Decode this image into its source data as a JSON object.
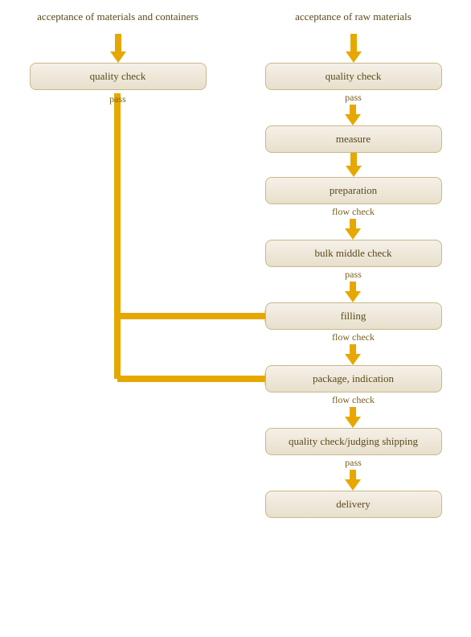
{
  "left": {
    "header": "acceptance of materials and containers",
    "quality_check": "quality check",
    "pass_label": "pass"
  },
  "right": {
    "header": "acceptance of raw materials",
    "quality_check": "quality check",
    "pass1_label": "pass",
    "measure": "measure",
    "preparation": "preparation",
    "flow_check1": "flow check",
    "bulk_middle": "bulk middle check",
    "pass2_label": "pass",
    "filling": "filling",
    "flow_check2": "flow check",
    "package": "package, indication",
    "flow_check3": "flow check",
    "quality_judge": "quality check/judging shipping",
    "pass3_label": "pass",
    "delivery": "delivery"
  },
  "colors": {
    "arrow": "#e6a800",
    "box_bg1": "#f5f0e8",
    "box_bg2": "#e8e0cc",
    "box_border": "#c8b88a",
    "text": "#5a4a1a"
  }
}
